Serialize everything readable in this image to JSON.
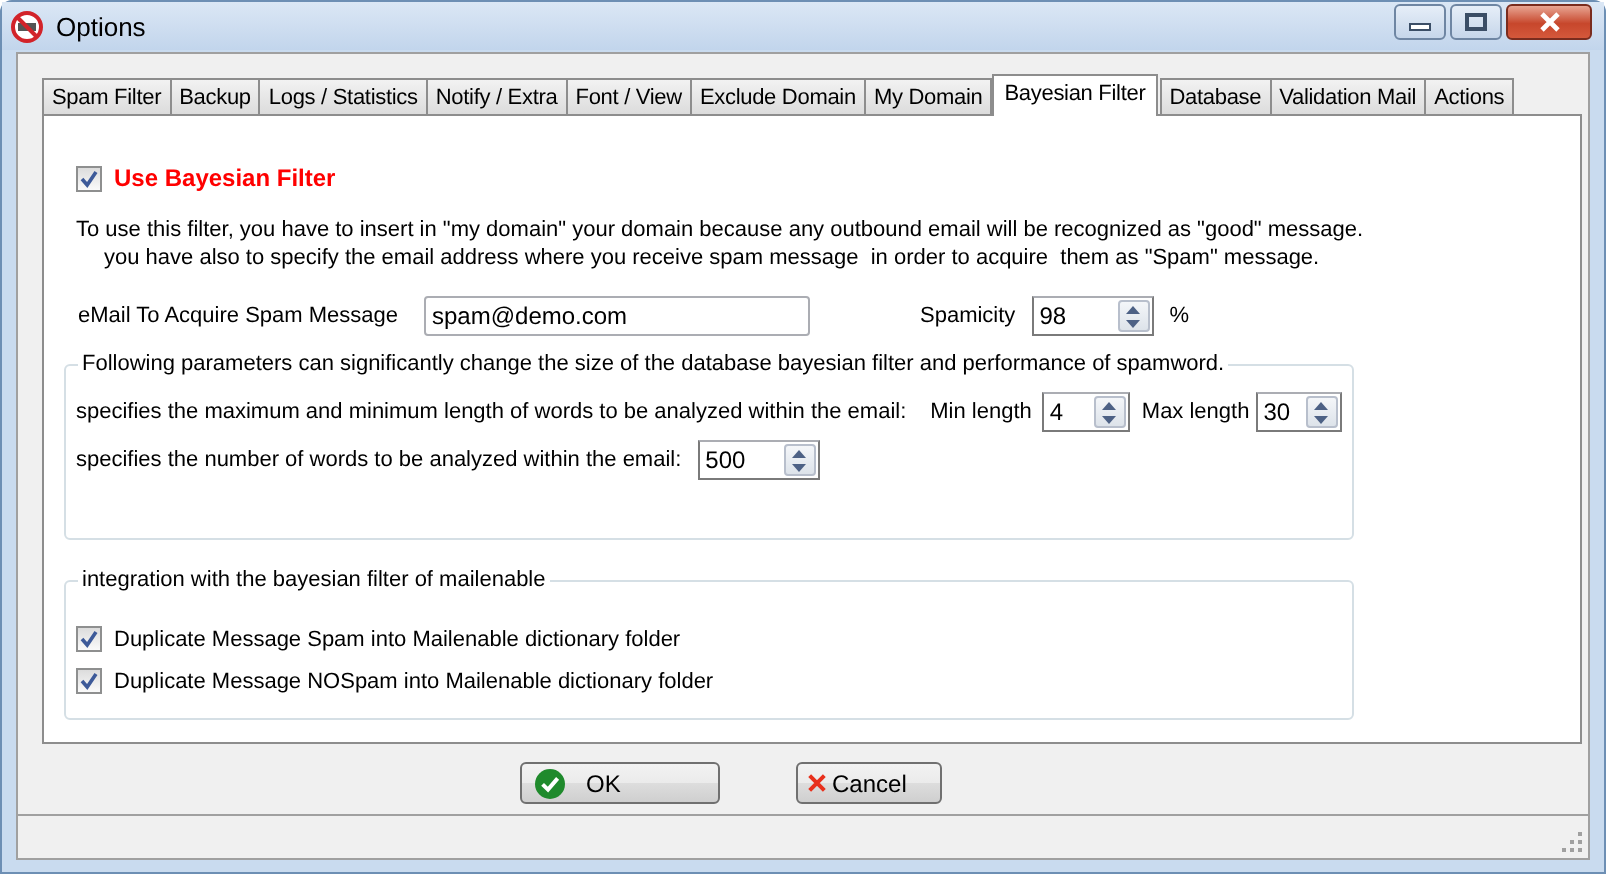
{
  "window": {
    "title": "Options"
  },
  "tabs": [
    {
      "label": "Spam Filter",
      "selected": false
    },
    {
      "label": "Backup",
      "selected": false
    },
    {
      "label": "Logs / Statistics",
      "selected": false
    },
    {
      "label": "Notify / Extra",
      "selected": false
    },
    {
      "label": "Font / View",
      "selected": false
    },
    {
      "label": "Exclude Domain",
      "selected": false
    },
    {
      "label": "My Domain",
      "selected": false
    },
    {
      "label": "Bayesian Filter",
      "selected": true
    },
    {
      "label": "Database",
      "selected": false
    },
    {
      "label": "Validation Mail",
      "selected": false
    },
    {
      "label": "Actions",
      "selected": false
    }
  ],
  "use_filter": {
    "label": "Use Bayesian Filter",
    "checked": true
  },
  "intro": [
    "To use this filter, you have to insert in \"my domain\" your domain because any outbound email will be recognized as \"good\" message.",
    "you have also to specify the email address where you receive spam message  in order to acquire  them as \"Spam\" message."
  ],
  "email": {
    "label": "eMail To Acquire Spam Message",
    "value": "spam@demo.com"
  },
  "spamicity": {
    "label": "Spamicity",
    "value": "98",
    "unit": "%"
  },
  "parameters": {
    "title": "Following parameters can significantly change the size of the database bayesian filter and performance of spamword.",
    "length_row": {
      "label": "specifies the maximum and minimum length of words to be analyzed within the email:",
      "min_label": "Min length",
      "min_value": "4",
      "max_label": "Max length",
      "max_value": "30"
    },
    "count_row": {
      "label": "specifies the number of words to be analyzed within the email:",
      "value": "500"
    }
  },
  "integration": {
    "title": "integration with the bayesian filter of mailenable",
    "options": [
      {
        "label": "Duplicate Message Spam into Mailenable dictionary folder",
        "checked": true
      },
      {
        "label": "Duplicate Message NOSpam into Mailenable dictionary folder",
        "checked": true
      }
    ]
  },
  "buttons": [
    {
      "label": "OK",
      "kind": "ok"
    },
    {
      "label": "Cancel",
      "kind": "cancel"
    }
  ]
}
